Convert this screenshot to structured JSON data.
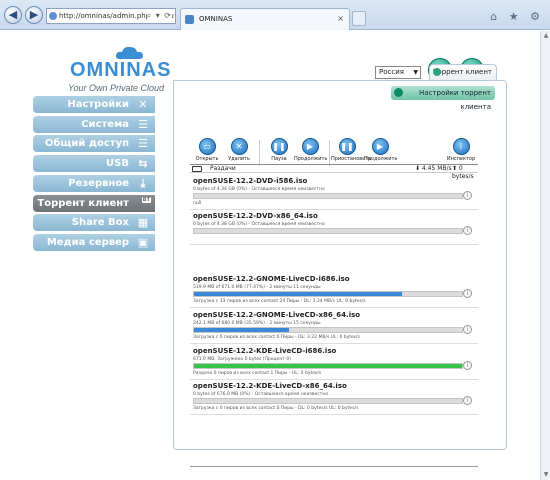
{
  "browser": {
    "url": "http://omninas/admin.php?menu",
    "tab_title": "OMNINAS",
    "close_glyph": "×",
    "address_tools": "⌕ ▾ ⟳",
    "window_tools": "⌂ ★ ⚙",
    "back_glyph": "◀",
    "forward_glyph": "▶"
  },
  "logo": {
    "name": "OMNINAS",
    "tagline": "Your Own Private Cloud"
  },
  "header": {
    "language": "Россия",
    "home_glyph": "⌂",
    "logout_glyph": "⇥"
  },
  "sidebar": {
    "items": [
      {
        "label": "Настройки",
        "icon": "✕"
      },
      {
        "label": "Система хранения",
        "icon": "☰"
      },
      {
        "label": "Общий доступ",
        "icon": "☰"
      },
      {
        "label": "USB",
        "icon": "⇆"
      },
      {
        "label": "Резервное",
        "icon": "⤓"
      },
      {
        "label": "Торрент клиент",
        "badge": "BT"
      },
      {
        "label": "Share Box",
        "icon": "▦"
      },
      {
        "label": "Медиа сервер",
        "icon": "▣"
      }
    ]
  },
  "main": {
    "tab_label": "Торрент клиент",
    "settings_button": "Настройки торрент клиента"
  },
  "toolbar": [
    {
      "label": "Открыть",
      "glyph": "▭"
    },
    {
      "label": "Удалить",
      "glyph": "✕"
    },
    {
      "label": "Пауза",
      "glyph": "❚❚"
    },
    {
      "label": "Продолжить",
      "glyph": "▶"
    },
    {
      "label": "Приостановить",
      "glyph": "❚❚"
    },
    {
      "label": "Продолжить",
      "glyph": "▶"
    },
    {
      "label": "Инспектор",
      "glyph": "i"
    }
  ],
  "status": {
    "label": "Раздачи",
    "download": "⬇ 4.45 MB/s",
    "upload": "⬆ 0 bytes/s"
  },
  "colors": {
    "blue_fill": "#3d87d8",
    "green_fill": "#35c24a",
    "gray_fill": "#c0c0c0"
  },
  "torrents": [
    {
      "name": "openSUSE-12.2-DVD-i586.iso",
      "sub": "0 bytes of 4.34 GB (0%) - Оставшееся время неизвестно",
      "foot": "null",
      "progress": 0,
      "color": "gray"
    },
    {
      "name": "openSUSE-12.2-DVD-x86_64.iso",
      "sub": "0 bytes of 4.38 GB (0%) - Оставшееся время неизвестно",
      "foot": "",
      "progress": 0,
      "color": "gray"
    },
    {
      "name": "openSUSE-12.2-GNOME-LiveCD-i686.iso",
      "sub": "519.9 MB of 671.0 MB (77.47%) - 2 минуты 11 секунды",
      "foot": "Загрузка с 13 пиров из всех contact 24 Пиры - DL: 1.24 MB/s UL: 0 bytes/s",
      "progress": 0.7747,
      "color": "blue"
    },
    {
      "name": "openSUSE-12.2-GNOME-LiveCD-x86_64.iso",
      "sub": "242.1 MB of 680.0 MB (35.59%) - 2 минуты 15 секунды",
      "foot": "Загрузка с 6 пиров из всех contact 6 Пиры - DL: 3.22 MB/s UL: 0 bytes/s",
      "progress": 0.3559,
      "color": "blue"
    },
    {
      "name": "openSUSE-12.2-KDE-LiveCD-i686.iso",
      "sub": "671.0 MB, Загружено 0 bytes (Процент 0)",
      "foot": "Раздача 0 пиров из всех contact 1 Пиры - UL: 0 bytes/s",
      "progress": 1,
      "color": "green"
    },
    {
      "name": "openSUSE-12.2-KDE-LiveCD-x86_64.iso",
      "sub": "0 bytes of 676.0 MB (0%) - Оставшееся время неизвестно",
      "foot": "Загрузка с 0 пиров из всех contact 0 Пиры - DL: 0 bytes/s UL: 0 bytes/s",
      "progress": 0,
      "color": "gray"
    }
  ]
}
